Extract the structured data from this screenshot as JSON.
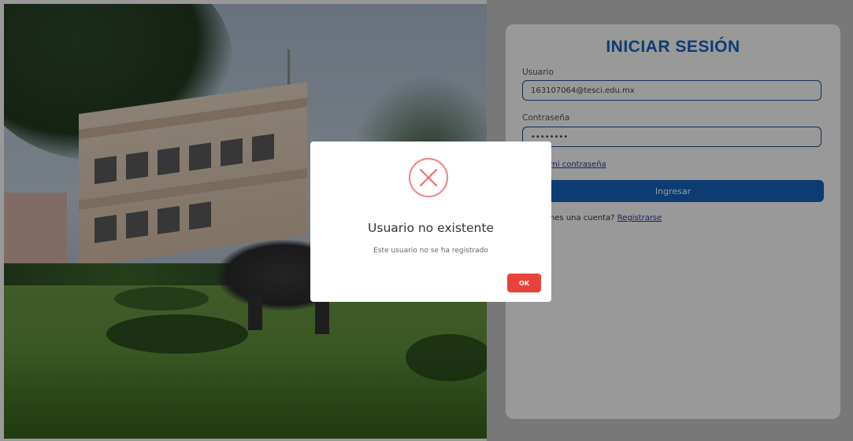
{
  "login": {
    "title": "INICIAR SESIÓN",
    "user_label": "Usuario",
    "user_value": "163107064@tesci.edu.mx",
    "password_label": "Contraseña",
    "password_value": "••••••••",
    "forgot_link": "Olvidé mi contraseña",
    "submit_label": "Ingresar",
    "signup_prompt": "¿No tienes una cuenta?",
    "signup_link": "Registrarse"
  },
  "modal": {
    "icon": "error-x-icon",
    "title": "Usuario no existente",
    "message": "Este usuario no se ha registrado",
    "ok_label": "OK"
  },
  "colors": {
    "accent": "#1664c0",
    "error": "#e8433a",
    "overlay": "rgba(0,0,0,0.40)"
  }
}
